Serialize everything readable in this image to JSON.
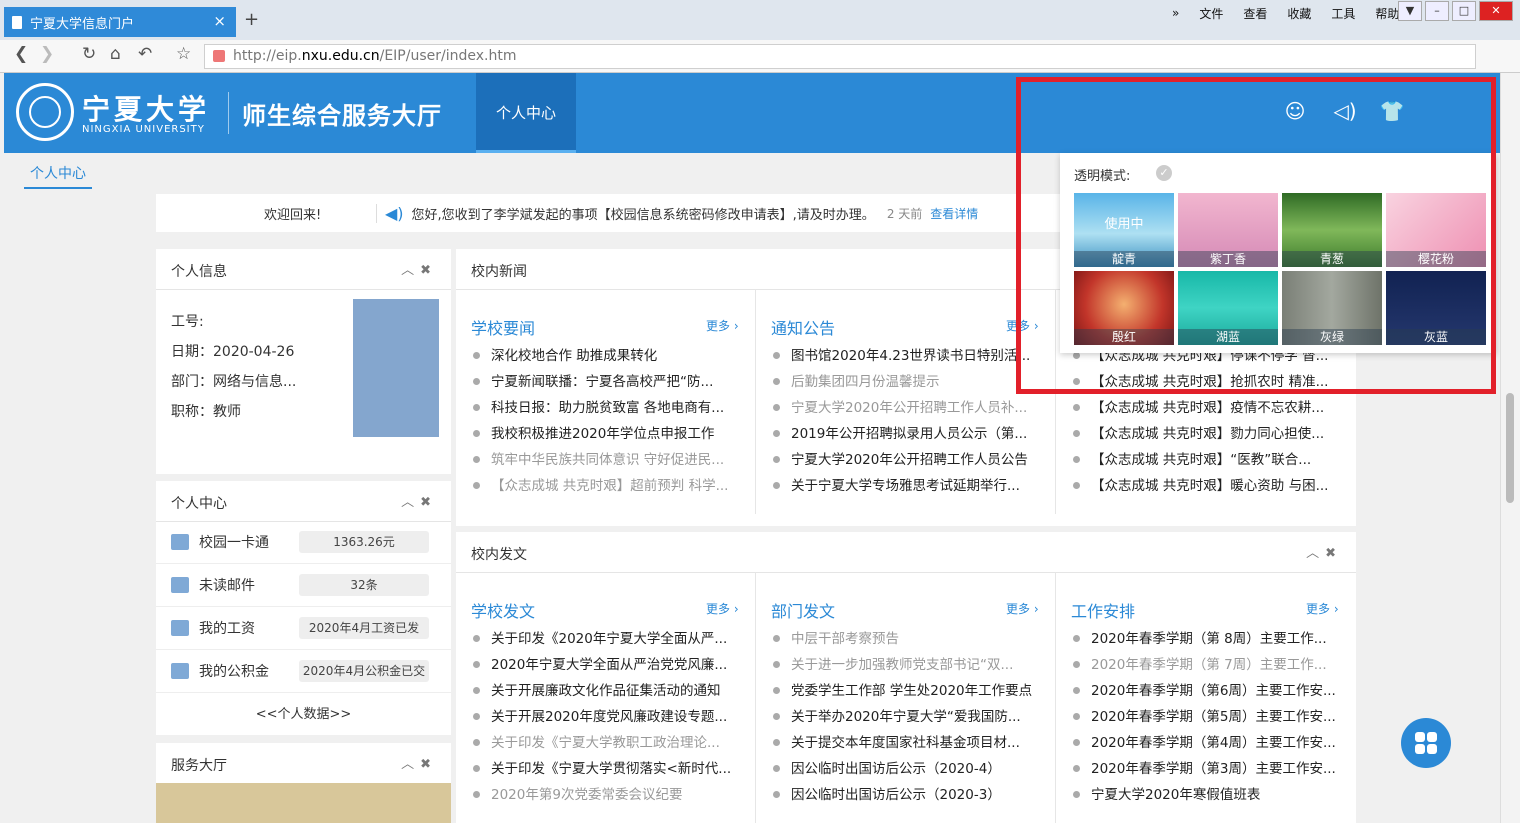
{
  "browser": {
    "tab_title": "宁夏大学信息门户",
    "tab_close": "×",
    "new_tab": "+",
    "menu": [
      "文件",
      "查看",
      "收藏",
      "工具",
      "帮助"
    ],
    "menu_more": "»",
    "url_host_prefix": "http://eip.",
    "url_host": "nxu.edu.cn",
    "url_path": "/EIP/user/index.htm"
  },
  "header": {
    "univ_name": "宁夏大学",
    "univ_name_en": "NINGXIA UNIVERSITY",
    "title": "师生综合服务大厅",
    "nav_active": "个人中心"
  },
  "breadcrumb": "个人中心",
  "welcome": {
    "greeting": "欢迎回来!",
    "message": "您好,您收到了李学斌发起的事项【校园信息系统密码修改申请表】,请及时办理。",
    "ago": "2 天前",
    "detail": "查看详情"
  },
  "personal_info": {
    "title": "个人信息",
    "id_label": "工号:",
    "date": "日期：2020-04-26",
    "dept": "部门：网络与信息...",
    "role": "职称：教师"
  },
  "personal_center": {
    "title": "个人中心",
    "items": [
      {
        "label": "校园一卡通",
        "value": "1363.26元"
      },
      {
        "label": "未读邮件",
        "value": "32条"
      },
      {
        "label": "我的工资",
        "value": "2020年4月工资已发"
      },
      {
        "label": "我的公积金",
        "value": "2020年4月公积金已交"
      }
    ],
    "more": "<<个人数据>>"
  },
  "service_hall": {
    "title": "服务大厅"
  },
  "campus_news": {
    "title": "校内新闻",
    "col1": {
      "head": "学校要闻",
      "more": "更多 ›",
      "items": [
        {
          "t": "深化校地合作 助推成果转化",
          "dim": false
        },
        {
          "t": "宁夏新闻联播：宁夏各高校严把“防...",
          "dim": false
        },
        {
          "t": "科技日报：助力脱贫致富 各地电商有...",
          "dim": false
        },
        {
          "t": "我校积极推进2020年学位点申报工作",
          "dim": false
        },
        {
          "t": "筑牢中华民族共同体意识 守好促进民...",
          "dim": true
        },
        {
          "t": "【众志成城 共克时艰】超前预判 科学...",
          "dim": true
        }
      ]
    },
    "col2": {
      "head": "通知公告",
      "more": "更多 ›",
      "items": [
        {
          "t": "图书馆2020年4.23世界读书日特别活...",
          "dim": false
        },
        {
          "t": "后勤集团四月份温馨提示",
          "dim": true
        },
        {
          "t": "宁夏大学2020年公开招聘工作人员补...",
          "dim": true
        },
        {
          "t": "2019年公开招聘拟录用人员公示（第...",
          "dim": false
        },
        {
          "t": "宁夏大学2020年公开招聘工作人员公告",
          "dim": false
        },
        {
          "t": "关于宁夏大学专场雅思考试延期举行...",
          "dim": false
        }
      ]
    },
    "col3": {
      "items": [
        {
          "t": "【众志成城 共克时艰】停课不停学 督...",
          "dim": false
        },
        {
          "t": "【众志成城 共克时艰】抢抓农时 精准...",
          "dim": false
        },
        {
          "t": "【众志成城 共克时艰】疫情不忘农耕...",
          "dim": false
        },
        {
          "t": "【众志成城 共克时艰】勠力同心担使...",
          "dim": false
        },
        {
          "t": "【众志成城 共克时艰】“医教”联合...",
          "dim": false
        },
        {
          "t": "【众志成城 共克时艰】暖心资助 与困...",
          "dim": false
        }
      ]
    }
  },
  "campus_docs": {
    "title": "校内发文",
    "col1": {
      "head": "学校发文",
      "more": "更多 ›",
      "items": [
        {
          "t": "关于印发《2020年宁夏大学全面从严...",
          "dim": false
        },
        {
          "t": "2020年宁夏大学全面从严治党党风廉...",
          "dim": false
        },
        {
          "t": "关于开展廉政文化作品征集活动的通知",
          "dim": false
        },
        {
          "t": "关于开展2020年度党风廉政建设专题...",
          "dim": false
        },
        {
          "t": "关于印发《宁夏大学教职工政治理论...",
          "dim": true
        },
        {
          "t": "关于印发《宁夏大学贯彻落实<新时代...",
          "dim": false
        },
        {
          "t": "2020年第9次党委常委会议纪要",
          "dim": true
        }
      ]
    },
    "col2": {
      "head": "部门发文",
      "more": "更多 ›",
      "items": [
        {
          "t": "中层干部考察预告",
          "dim": true
        },
        {
          "t": "关于进一步加强教师党支部书记“双...",
          "dim": true
        },
        {
          "t": "党委学生工作部 学生处2020年工作要点",
          "dim": false
        },
        {
          "t": "关于举办2020年宁夏大学“爱我国防...",
          "dim": false
        },
        {
          "t": "关于提交本年度国家社科基金项目材...",
          "dim": false
        },
        {
          "t": "因公临时出国访后公示（2020-4）",
          "dim": false
        },
        {
          "t": "因公临时出国访后公示（2020-3）",
          "dim": false
        }
      ]
    },
    "col3": {
      "head": "工作安排",
      "more": "更多 ›",
      "items": [
        {
          "t": "2020年春季学期（第 8周）主要工作...",
          "dim": false
        },
        {
          "t": "2020年春季学期（第 7周）主要工作...",
          "dim": true
        },
        {
          "t": "2020年春季学期（第6周）主要工作安...",
          "dim": false
        },
        {
          "t": "2020年春季学期（第5周）主要工作安...",
          "dim": false
        },
        {
          "t": "2020年春季学期（第4周）主要工作安...",
          "dim": false
        },
        {
          "t": "2020年春季学期（第3周）主要工作安...",
          "dim": false
        },
        {
          "t": "宁夏大学2020年寒假值班表",
          "dim": false
        }
      ]
    }
  },
  "skin_panel": {
    "transparent_label": "透明模式:",
    "in_use": "使用中",
    "skins": [
      {
        "name": "靛青",
        "color": "#4aa6d8"
      },
      {
        "name": "紫丁香",
        "color": "#d98ab8"
      },
      {
        "name": "青葱",
        "color": "#4f8a3a"
      },
      {
        "name": "樱花粉",
        "color": "#f0a4c0"
      },
      {
        "name": "殷红",
        "color": "#c0392b"
      },
      {
        "name": "湖蓝",
        "color": "#1fc0b0"
      },
      {
        "name": "灰绿",
        "color": "#8a8f86"
      },
      {
        "name": "灰蓝",
        "color": "#1c2f5e"
      }
    ]
  },
  "colors": {
    "brand": "#2b89d6",
    "highlight": "#e2202a"
  }
}
